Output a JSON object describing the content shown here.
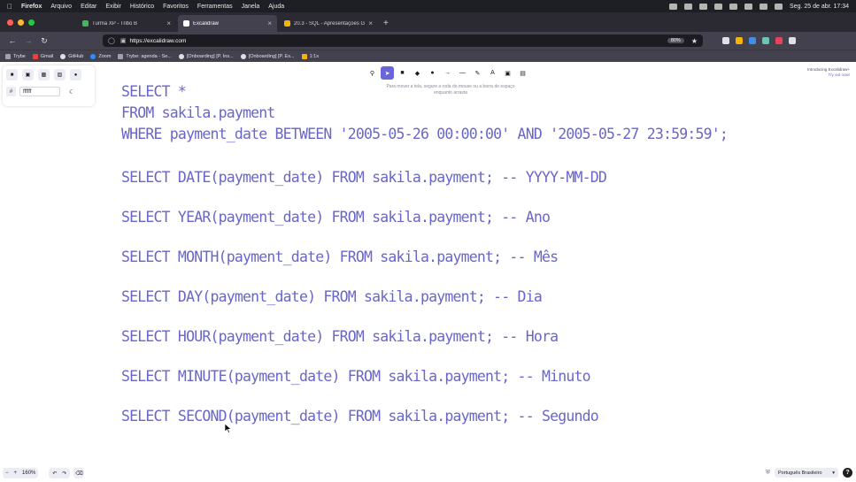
{
  "menubar": {
    "items": [
      "Firefox",
      "Arquivo",
      "Editar",
      "Exibir",
      "Histórico",
      "Favoritos",
      "Ferramentas",
      "Janela",
      "Ajuda"
    ],
    "clock": "Seg. 25 de abr.  17:34"
  },
  "tabs": [
    {
      "title": "Turma XP - Tribo B",
      "favicon_color": "#3cba54"
    },
    {
      "title": "Excalidraw",
      "favicon_color": "#ffffff"
    },
    {
      "title": "20.3 - SQL - Apresentações G...",
      "favicon_color": "#f4b400"
    }
  ],
  "navbar": {
    "url": "https://excalidraw.com",
    "zoom": "80%"
  },
  "bookmarks": [
    {
      "label": "Trybe",
      "icon_color": "#a0a0a8"
    },
    {
      "label": "Gmail",
      "icon_color": "#ea4335"
    },
    {
      "label": "GitHub",
      "icon_color": "#e0e0e0"
    },
    {
      "label": "Zoom",
      "icon_color": "#2d8cff"
    },
    {
      "label": "Trybe: agenda - Se...",
      "icon_color": "#a0a0a8"
    },
    {
      "label": "[Onboarding] [P. Ins...",
      "icon_color": "#e0e0e0"
    },
    {
      "label": "[Onboarding] [P. Es...",
      "icon_color": "#e0e0e0"
    },
    {
      "label": "1:1s",
      "icon_color": "#f4b400"
    }
  ],
  "excalidraw": {
    "background_color": "ffffff",
    "tool_hint": "Para mover a tela, segure a roda do mouse ou a barra de espaço enquanto arrasta",
    "promo_title": "Introducing Excalidraw+",
    "promo_link": "Try out now!",
    "zoom_level": "160%",
    "language": "Português Brasileiro",
    "accent_color": "#6965db"
  },
  "code_lines": [
    "SELECT *",
    "FROM sakila.payment",
    "WHERE payment_date BETWEEN '2005-05-26 00:00:00' AND '2005-05-27 23:59:59';",
    "SELECT DATE(payment_date) FROM sakila.payment; -- YYYY-MM-DD",
    "SELECT YEAR(payment_date) FROM sakila.payment; -- Ano",
    "SELECT MONTH(payment_date) FROM sakila.payment; -- Mês",
    "SELECT DAY(payment_date) FROM sakila.payment; -- Dia",
    "SELECT HOUR(payment_date) FROM sakila.payment; -- Hora",
    "SELECT MINUTE(payment_date) FROM sakila.payment; -- Minuto",
    "SELECT SECOND(payment_date) FROM sakila.payment; -- Segundo"
  ]
}
